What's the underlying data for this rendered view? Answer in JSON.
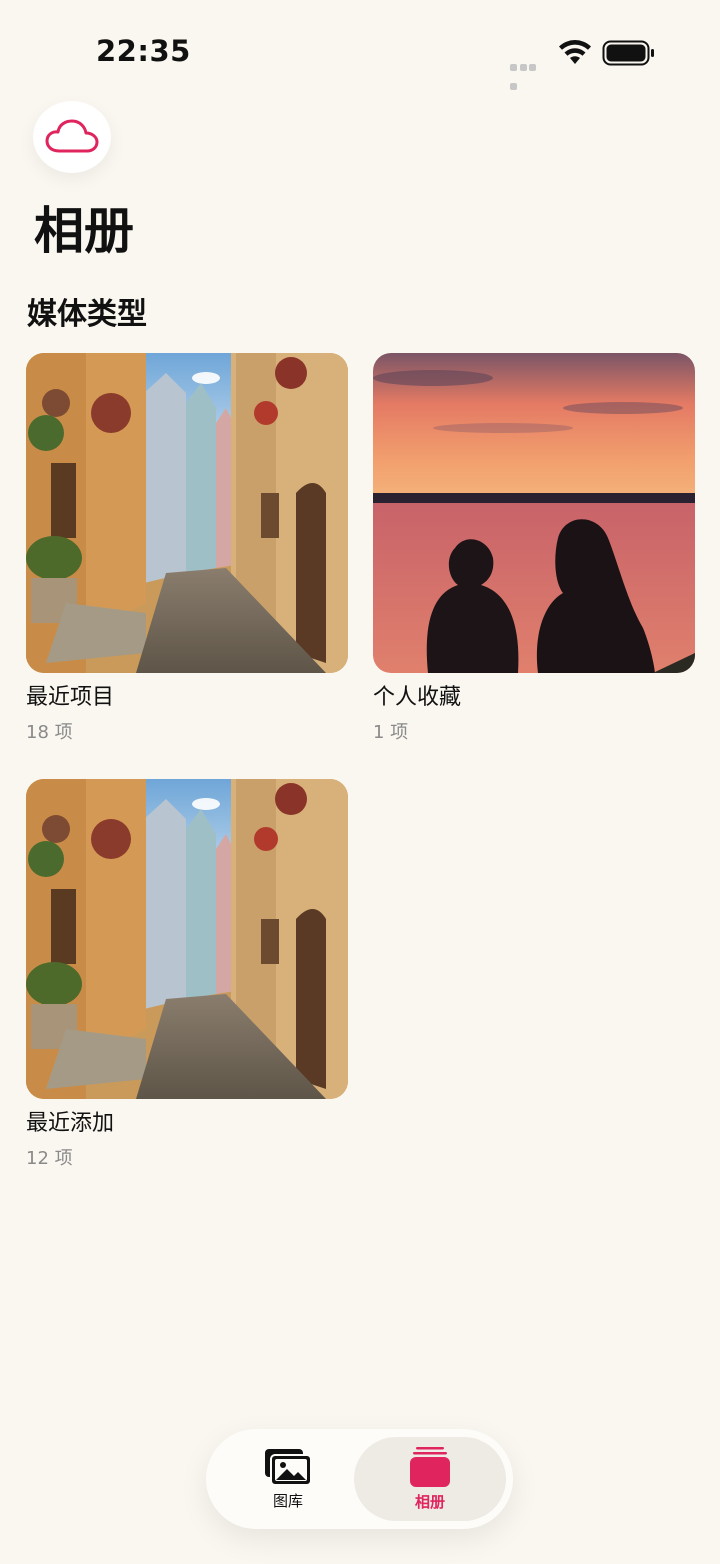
{
  "status": {
    "time": "22:35"
  },
  "colors": {
    "accent": "#e0245e",
    "background": "#faf7f0"
  },
  "header": {
    "cloud_icon": "cloud-icon",
    "title": "相册"
  },
  "section": {
    "title": "媒体类型"
  },
  "albums": [
    {
      "name": "最近项目",
      "count": "18 项"
    },
    {
      "name": "个人收藏",
      "count": "1 项"
    },
    {
      "name": "最近添加",
      "count": "12 项"
    }
  ],
  "tabbar": {
    "library_label": "图库",
    "albums_label": "相册",
    "selected": "相册"
  }
}
